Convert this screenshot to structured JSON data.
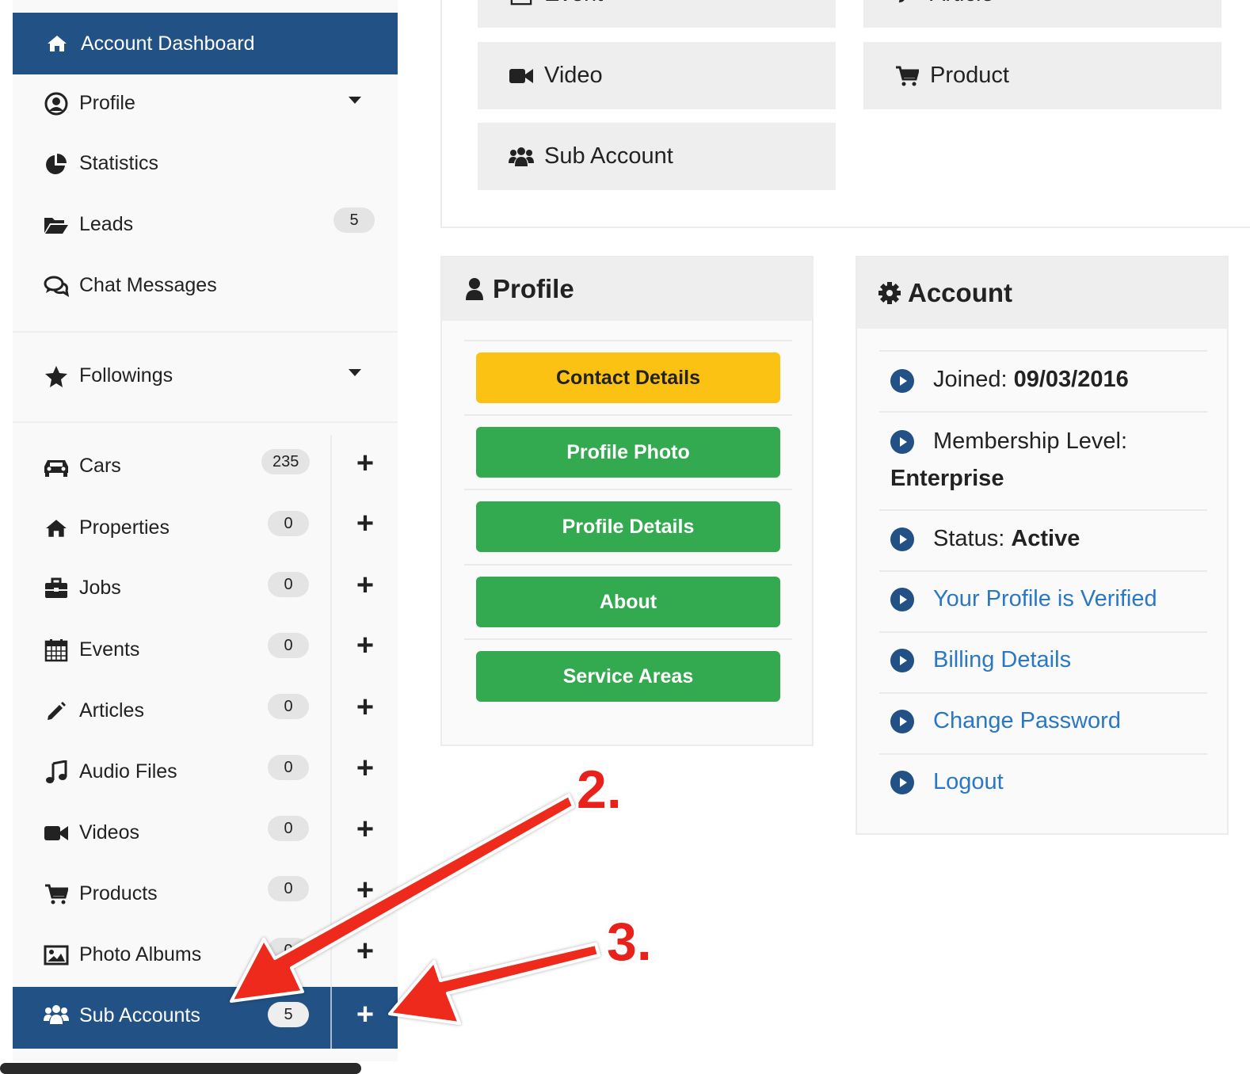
{
  "sidebar": {
    "dashboard_label": "Account Dashboard",
    "items": [
      {
        "label": "Profile",
        "icon": "user-circle-icon",
        "caret": true
      },
      {
        "label": "Statistics",
        "icon": "pie-chart-icon"
      },
      {
        "label": "Leads",
        "icon": "folder-open-icon",
        "badge": "5"
      },
      {
        "label": "Chat Messages",
        "icon": "comments-icon"
      }
    ],
    "followings_label": "Followings",
    "listings": [
      {
        "label": "Cars",
        "icon": "car-icon",
        "badge": "235"
      },
      {
        "label": "Properties",
        "icon": "home-icon",
        "badge": "0"
      },
      {
        "label": "Jobs",
        "icon": "briefcase-icon",
        "badge": "0"
      },
      {
        "label": "Events",
        "icon": "calendar-icon",
        "badge": "0"
      },
      {
        "label": "Articles",
        "icon": "pencil-icon",
        "badge": "0"
      },
      {
        "label": "Audio Files",
        "icon": "music-icon",
        "badge": "0"
      },
      {
        "label": "Videos",
        "icon": "video-camera-icon",
        "badge": "0"
      },
      {
        "label": "Products",
        "icon": "shopping-cart-icon",
        "badge": "0"
      },
      {
        "label": "Photo Albums",
        "icon": "image-icon",
        "badge": "0"
      }
    ],
    "active": {
      "label": "Sub Accounts",
      "icon": "users-icon",
      "badge": "5"
    },
    "plus_symbol": "+"
  },
  "quick_add": {
    "buttons": [
      {
        "label": "Event",
        "icon": "calendar-icon"
      },
      {
        "label": "Article",
        "icon": "pencil-icon"
      },
      {
        "label": "Video",
        "icon": "video-camera-icon"
      },
      {
        "label": "Product",
        "icon": "shopping-cart-icon"
      },
      {
        "label": "Sub Account",
        "icon": "users-icon"
      }
    ]
  },
  "profile_panel": {
    "title": "Profile",
    "buttons": [
      "Contact Details",
      "Profile Photo",
      "Profile Details",
      "About",
      "Service Areas"
    ]
  },
  "account_panel": {
    "title": "Account",
    "joined_label": "Joined: ",
    "joined_value": "09/03/2016",
    "membership_label": "Membership Level:",
    "membership_value": "Enterprise",
    "status_label": "Status: ",
    "status_value": "Active",
    "links": [
      "Your Profile is Verified",
      "Billing Details",
      "Change Password",
      "Logout"
    ]
  },
  "annotations": {
    "step2": "2.",
    "step3": "3."
  },
  "colors": {
    "primary": "#215185",
    "yellow": "#fbc213",
    "green": "#33aa4f",
    "link": "#2a77c4",
    "annotation": "#e8221b"
  }
}
